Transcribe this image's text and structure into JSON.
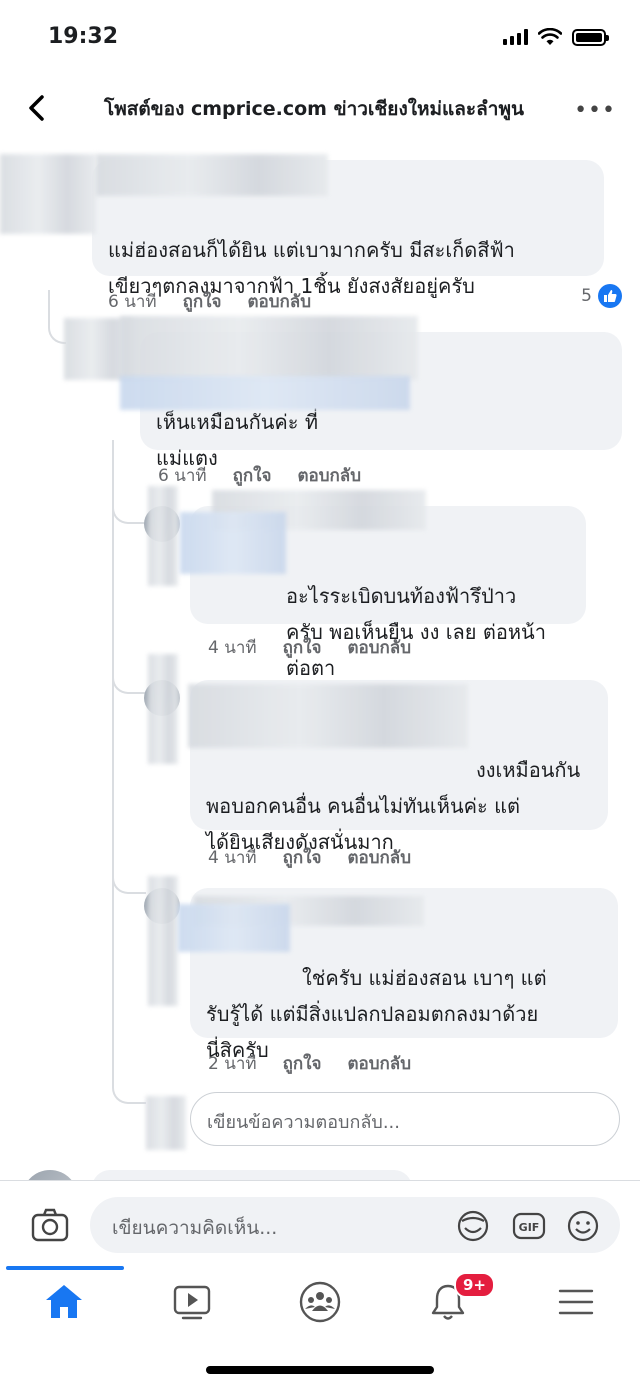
{
  "status_bar": {
    "time": "19:32"
  },
  "header": {
    "title": "โพสต์ของ cmprice.com ข่าวเชียงใหม่และลำพูน"
  },
  "labels": {
    "like": "ถูกใจ",
    "reply": "ตอบกลับ"
  },
  "comments": [
    {
      "text": "แม่ฮ่องสอนก็ได้ยิน แต่เบามากครับ มีสะเก็ดสีฟ้า\nเขียวๆตกลงมาจากฟ้า 1ชิ้น ยังสงสัยอยู่ครับ",
      "time": "6 นาที",
      "reactions": "5"
    },
    {
      "text": "เห็นเหมือนกันค่ะ ที่\nแม่แตง",
      "time": "6 นาที"
    },
    {
      "text": "อะไรระเบิดบนท้องฟ้ารึป่าว\nครับ พอเห็นยืน งง เลย ต่อหน้าต่อตา",
      "time": "4 นาที"
    },
    {
      "text": "งงเหมือนกัน\nพอบอกคนอื่น คนอื่นไม่ทันเห็นค่ะ แต่\nได้ยินเสียงดังสนั่นมาก",
      "time": "4 นาที"
    },
    {
      "text": "ใช่ครับ แม่ฮ่องสอน เบาๆ แต่\nรับรู้ได้ แต่มีสิ่งแปลกปลอมตกลงมาด้วย\nนี่สิครับ",
      "time": "2 นาที"
    }
  ],
  "reply_input": {
    "placeholder": "เขียนข้อความตอบกลับ..."
  },
  "comment_input": {
    "placeholder": "เขียนความคิดเห็น..."
  },
  "tabs": {
    "notifications_badge": "9+",
    "icons": [
      "home-icon",
      "watch-icon",
      "groups-icon",
      "notifications-icon",
      "menu-icon"
    ]
  },
  "colors": {
    "accent": "#1877f2",
    "bubble": "#f0f2f5",
    "badge": "#e41e3f"
  }
}
